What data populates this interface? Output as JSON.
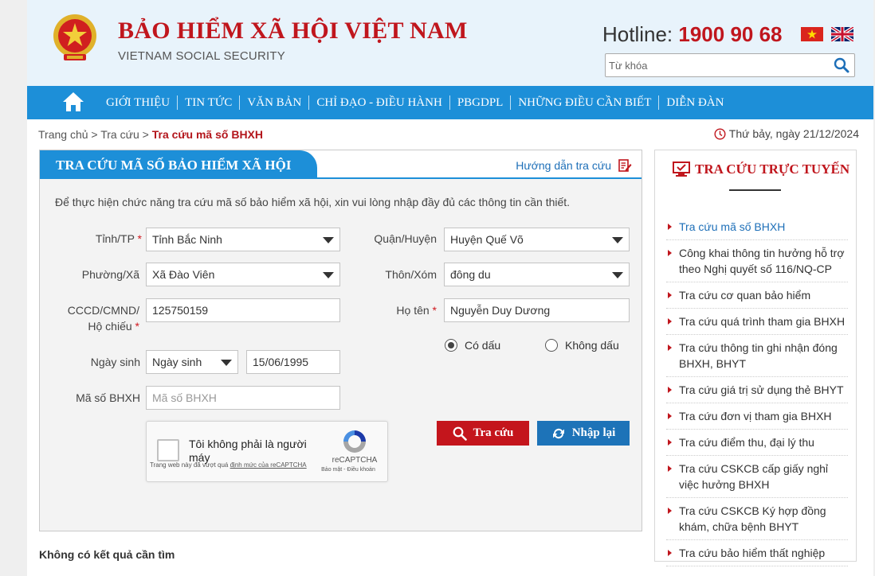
{
  "header": {
    "title": "BẢO HIỂM XÃ HỘI VIỆT NAM",
    "subtitle": "VIETNAM SOCIAL SECURITY",
    "hotline_label": "Hotline:",
    "hotline_number": "1900 90 68",
    "search_placeholder": "Từ khóa"
  },
  "nav": {
    "items": [
      "GIỚI THIỆU",
      "TIN TỨC",
      "VĂN BẢN",
      "CHỈ ĐẠO - ĐIỀU HÀNH",
      "PBGDPL",
      "NHỮNG ĐIỀU CẦN BIẾT",
      "DIỄN ĐÀN"
    ]
  },
  "breadcrumb": {
    "home": "Trang chủ",
    "section": "Tra cứu",
    "current": "Tra cứu mã số BHXH",
    "date": "Thứ bảy, ngày 21/12/2024"
  },
  "panel": {
    "title": "TRA CỨU MÃ SỐ BẢO HIỂM XÃ HỘI",
    "guide_link": "Hướng dẫn tra cứu",
    "intro": "Để thực hiện chức năng tra cứu mã số bảo hiểm xã hội, xin vui lòng nhập đầy đủ các thông tin cần thiết.",
    "fields": {
      "province_label": "Tỉnh/TP",
      "province_value": "Tỉnh Bắc Ninh",
      "district_label": "Quận/Huyện",
      "district_value": "Huyện Quế Võ",
      "ward_label": "Phường/Xã",
      "ward_value": "Xã Đào Viên",
      "village_label": "Thôn/Xóm",
      "village_value": "đông du",
      "id_label_1": "CCCD/CMND/",
      "id_label_2": "Hộ chiếu",
      "id_value": "125750159",
      "name_label": "Họ tên",
      "name_value": "Nguyễn Duy Dương",
      "dob_label": "Ngày sinh",
      "dob_type_value": "Ngày sinh",
      "dob_value": "15/06/1995",
      "bhxh_label": "Mã số BHXH",
      "bhxh_placeholder": "Mã số BHXH",
      "required_mark": "*"
    },
    "radios": {
      "with_accent": "Có dấu",
      "without_accent": "Không dấu"
    },
    "captcha": {
      "label": "Tôi không phải là người máy",
      "footer_prefix": "Trang web này đã vượt quá ",
      "footer_link": "định mức của reCAPTCHA",
      "brand": "reCAPTCHA",
      "links": "Bảo mật - Điều khoản"
    },
    "buttons": {
      "search": "Tra cứu",
      "reset": "Nhập lại"
    },
    "no_result": "Không có kết quả cần tìm"
  },
  "sidebar": {
    "title": "TRA CỨU TRỰC TUYẾN",
    "items": [
      "Tra cứu mã số BHXH",
      "Công khai thông tin hưởng hỗ trợ theo Nghị quyết số 116/NQ-CP",
      "Tra cứu cơ quan bảo hiểm",
      "Tra cứu quá trình tham gia BHXH",
      "Tra cứu thông tin ghi nhận đóng BHXH, BHYT",
      "Tra cứu giá trị sử dụng thẻ BHYT",
      "Tra cứu đơn vị tham gia BHXH",
      "Tra cứu điểm thu, đại lý thu",
      "Tra cứu CSKCB cấp giấy nghỉ việc hưởng BHXH",
      "Tra cứu CSKCB Ký hợp đồng khám, chữa bệnh BHYT",
      "Tra cứu bảo hiểm thất nghiệp"
    ]
  },
  "colors": {
    "brand_red": "#c0161d",
    "nav_blue": "#1d8fd8",
    "button_blue": "#1d73b8"
  }
}
